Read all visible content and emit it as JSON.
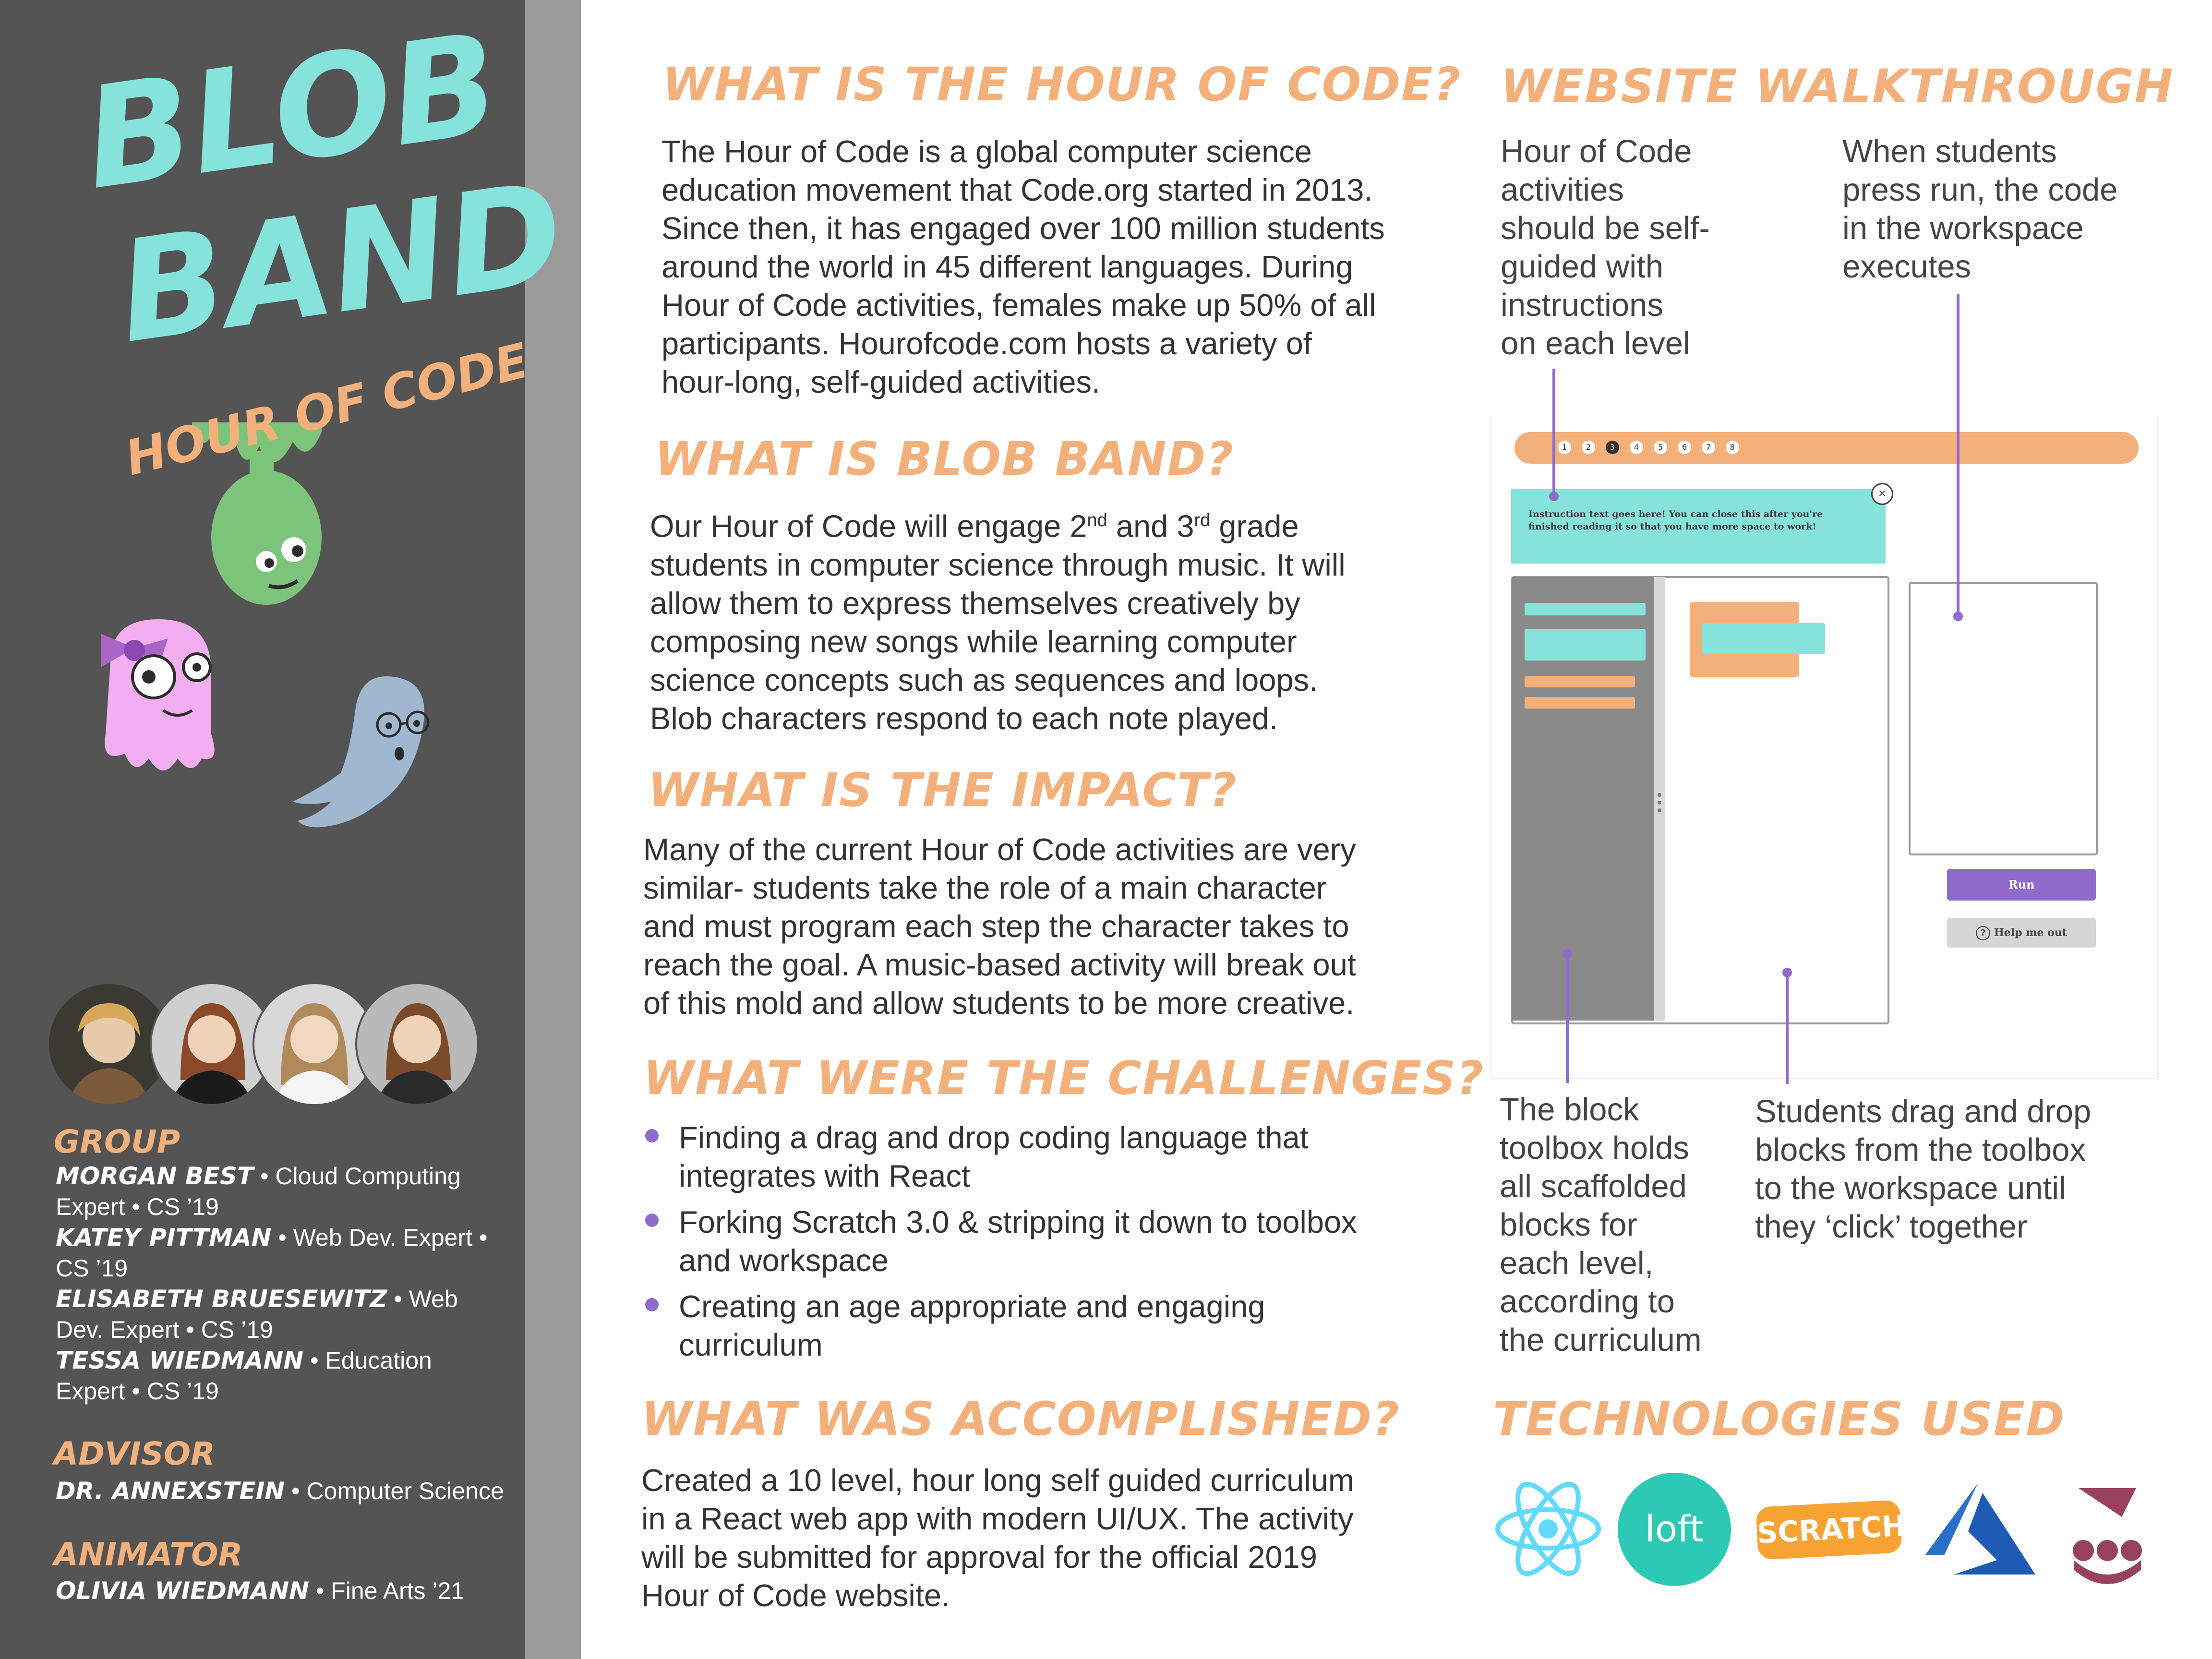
{
  "sidebar": {
    "title_line1": "BLOB",
    "title_line2": "BAND",
    "subtitle": "HOUR OF CODE",
    "group_heading": "GROUP",
    "members": [
      {
        "name": "MORGAN BEST",
        "role": " • Cloud Computing Expert • CS ’19"
      },
      {
        "name": "KATEY PITTMAN",
        "role": " • Web Dev. Expert • CS ’19"
      },
      {
        "name": "ELISABETH BRUESEWITZ",
        "role": " • Web Dev. Expert • CS ’19"
      },
      {
        "name": "TESSA WIEDMANN",
        "role": " • Education Expert • CS ’19"
      }
    ],
    "advisor_heading": "ADVISOR",
    "advisor": {
      "name": "DR. ANNEXSTEIN",
      "role": " • Computer Science"
    },
    "animator_heading": "ANIMATOR",
    "animator": {
      "name": "OLIVIA WIEDMANN",
      "role": " • Fine Arts ’21"
    }
  },
  "sections": {
    "hour_of_code": {
      "heading": "WHAT IS THE HOUR OF CODE?",
      "lines": [
        "The Hour of Code is a global computer science",
        "education movement that Code.org started in 2013.",
        "Since then, it has engaged over 100 million students",
        "around the world in 45 different languages. During",
        "Hour of Code activities, females make up 50% of all",
        "participants. Hourofcode.com hosts a variety of",
        "hour-long, self-guided activities."
      ]
    },
    "blob_band": {
      "heading": "WHAT IS BLOB BAND?",
      "line1_a": "Our Hour of Code will engage 2",
      "line1_sup1": "nd",
      "line1_b": " and 3",
      "line1_sup2": "rd",
      "line1_c": " grade",
      "lines": [
        "students in computer science through music. It will",
        "allow them to express themselves creatively by",
        "composing new songs while learning computer",
        "science concepts such as sequences and loops.",
        "Blob characters respond to each note played."
      ]
    },
    "impact": {
      "heading": "WHAT IS THE IMPACT?",
      "lines": [
        "Many of the current Hour of Code activities are very",
        "similar- students take the role of a main character",
        "and must program each step the character takes to",
        "reach the goal. A music-based activity will break out",
        "of this mold and allow students to be more creative."
      ]
    },
    "challenges": {
      "heading": "WHAT WERE THE CHALLENGES?",
      "bullets": [
        [
          "Finding a drag and drop coding language that",
          "integrates with React"
        ],
        [
          "Forking Scratch 3.0 & stripping it down to toolbox",
          "and workspace"
        ],
        [
          "Creating an age appropriate and engaging",
          "curriculum"
        ]
      ]
    },
    "accomplished": {
      "heading": "WHAT WAS ACCOMPLISHED?",
      "lines": [
        "Created a 10 level, hour long self guided curriculum",
        "in a React web app with modern UI/UX. The activity",
        "will be submitted for approval for the official 2019",
        "Hour of Code website."
      ]
    },
    "walkthrough": {
      "heading": "WEBSITE WALKTHROUGH",
      "callout_instructions": [
        "Hour of Code",
        "activities",
        "should be self-",
        "guided with",
        "instructions",
        "on each level"
      ],
      "callout_run": [
        "When students",
        "press run, the code",
        "in the workspace",
        "executes"
      ],
      "callout_toolbox": [
        "The block",
        "toolbox holds",
        "all scaffolded",
        "blocks for",
        "each level,",
        "according to",
        "the curriculum"
      ],
      "callout_workspace": [
        "Students drag and drop",
        "blocks from the toolbox",
        "to the workspace until",
        "they ‘click’ together"
      ],
      "mock": {
        "levels": [
          "1",
          "2",
          "3",
          "4",
          "5",
          "6",
          "7",
          "8"
        ],
        "current_level": "3",
        "instruction_text": "Instruction text goes here! You can close this after you're finished reading it so that you have more space to work!",
        "run_label": "Run",
        "help_label": "Help me out",
        "help_icon": "question-circle-icon",
        "close_icon": "close-icon"
      }
    },
    "technologies": {
      "heading": "TECHNOLOGIES USED",
      "logos": [
        "react-logo",
        "loft-logo",
        "scratch-logo",
        "azure-logo",
        "jest-logo"
      ],
      "loft_text": "loft",
      "scratch_text": "SCRATCH"
    }
  },
  "colors": {
    "sidebar": "#545454",
    "strip": "#9b9b9b",
    "heading_orange": "#f4b07a",
    "title_teal": "#86e3db",
    "accent_purple": "#8f6ccc",
    "mock_orange": "#f4b07a",
    "mock_teal": "#86e3db"
  }
}
